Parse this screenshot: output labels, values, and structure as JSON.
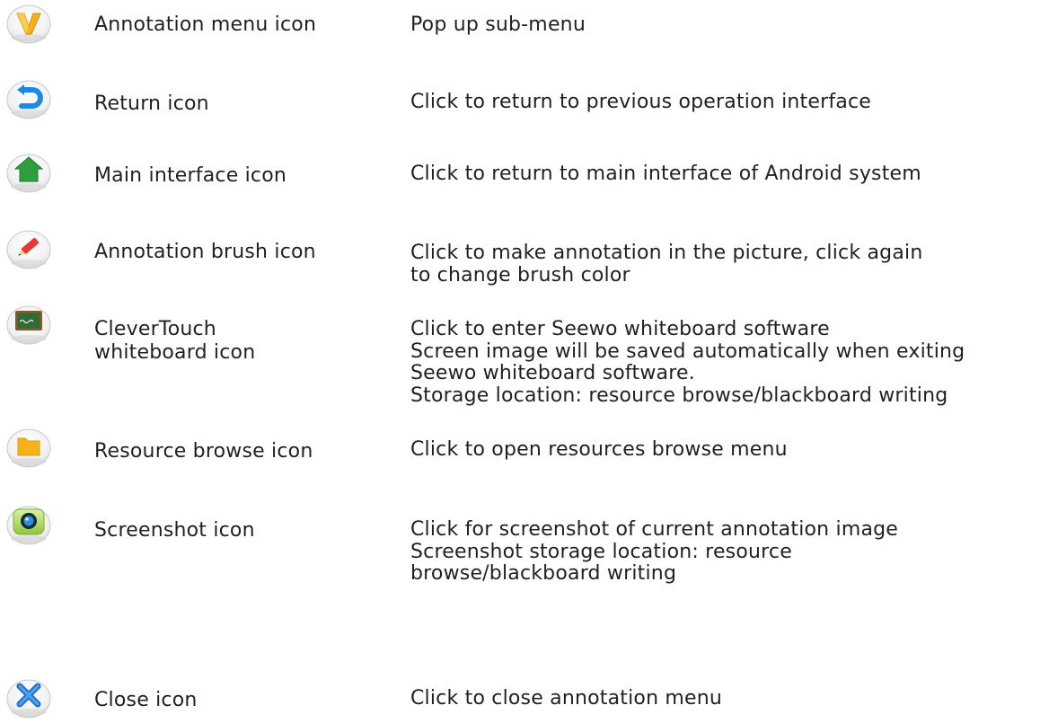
{
  "rows": [
    {
      "icon": "annotation-menu-icon",
      "name": "Annotation menu icon",
      "description": "Pop up sub-menu"
    },
    {
      "icon": "return-icon",
      "name": "Return icon",
      "description": "Click to return to previous operation interface"
    },
    {
      "icon": "home-icon",
      "name": "Main interface icon",
      "description": "Click to return to main interface of Android system"
    },
    {
      "icon": "pencil-icon",
      "name": "Annotation brush icon",
      "description": "Click to make annotation in the picture, click again\nto change brush color"
    },
    {
      "icon": "whiteboard-icon",
      "name": "CleverTouch\nwhiteboard icon",
      "description": "Click to enter Seewo whiteboard software\nScreen image will be saved automatically when exiting\nSeewo whiteboard software.\nStorage location: resource browse/blackboard writing"
    },
    {
      "icon": "folder-icon",
      "name": "Resource browse icon",
      "description": "Click to open resources browse menu"
    },
    {
      "icon": "camera-icon",
      "name": "Screenshot icon",
      "description": "Click for screenshot of current annotation image\nScreenshot storage location: resource\nbrowse/blackboard writing"
    },
    {
      "icon": "close-icon",
      "name": "Close icon",
      "description": "Click to close annotation menu"
    }
  ]
}
